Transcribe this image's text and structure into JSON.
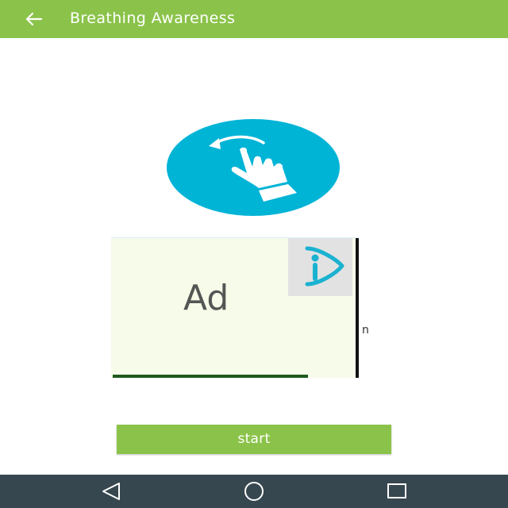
{
  "app_bar": {
    "title": "Breathing Awareness",
    "back_icon": "arrow-left-icon",
    "background_color": "#8bc34a"
  },
  "gesture": {
    "icon": "swipe-gesture-icon",
    "background_color": "#00b4d6"
  },
  "ad": {
    "label": "Ad",
    "badge_icon": "ad-choices-icon",
    "overflow_text": "n"
  },
  "start_button": {
    "label": "start",
    "color": "#8bc34a"
  },
  "navigation_bar": {
    "back_icon": "nav-back-icon",
    "home_icon": "nav-home-icon",
    "recents_icon": "nav-recents-icon",
    "background_color": "#37474f"
  }
}
